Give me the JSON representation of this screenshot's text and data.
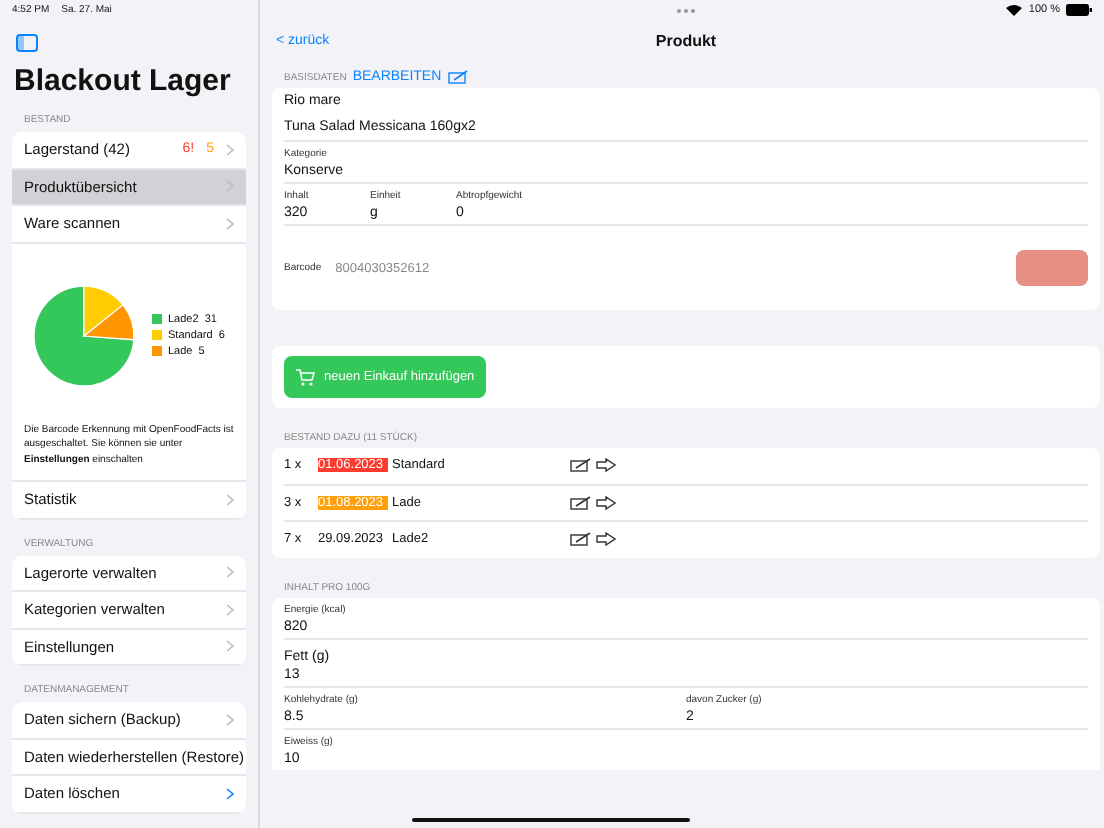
{
  "status_bar": {
    "time": "4:52 PM",
    "date": "Sa. 27. Mai",
    "battery": "100 %"
  },
  "sidebar": {
    "title": "Blackout Lager",
    "sections": [
      {
        "header": "BESTAND",
        "items": [
          {
            "label": "Lagerstand  (42)",
            "badges": [
              {
                "text": "6!",
                "color": "#ff3b30"
              },
              {
                "text": "5",
                "color": "#ff9f0a"
              }
            ],
            "selected": false
          },
          {
            "label": "Produktübersicht",
            "selected": true
          },
          {
            "label": "Ware scannen",
            "selected": false
          }
        ],
        "legend": [
          {
            "label": "Lade2",
            "count": "31",
            "color": "#34c759"
          },
          {
            "label": "Standard",
            "count": "6",
            "color": "#ffcc00"
          },
          {
            "label": "Lade",
            "count": "5",
            "color": "#ff9500"
          }
        ],
        "note": "Die Barcode Erkennung mit OpenFoodFacts ist ausgeschaltet. Sie können sie unter **Einstellungen** einschalten",
        "footer_items": [
          {
            "label": "Statistik",
            "selected": false
          }
        ]
      },
      {
        "header": "VERWALTUNG",
        "items": [
          {
            "label": "Lagerorte verwalten",
            "selected": false
          },
          {
            "label": "Kategorien verwalten",
            "selected": false
          },
          {
            "label": "Einstellungen",
            "selected": false
          }
        ]
      },
      {
        "header": "DATENMANAGEMENT",
        "items": [
          {
            "label": "Daten sichern (Backup)",
            "selected": false
          },
          {
            "label": "Daten wiederherstellen (Restore)",
            "selected": false
          },
          {
            "label": "Daten löschen",
            "selected": false
          }
        ]
      }
    ]
  },
  "nav": {
    "back": "< zurück",
    "title": "Produkt"
  },
  "basisdaten": {
    "header": "BASISDATEN",
    "edit": "BEARBEITEN",
    "brand": "Rio mare",
    "name": "Tuna Salad Messicana 160gx2",
    "category_label": "Kategorie",
    "category": "Konserve",
    "fields": [
      {
        "label": "Inhalt",
        "value": "320"
      },
      {
        "label": "Einheit",
        "value": "g"
      },
      {
        "label": "Abtropfgewicht",
        "value": "0"
      }
    ],
    "barcode_label": "Barcode",
    "barcode": "8004030352612"
  },
  "add_button": "neuen Einkauf hinzufügen",
  "stock": {
    "header": "BESTAND DAZU (11 STÜCK)",
    "rows": [
      {
        "qty": "1 x",
        "date": "01.06.2023",
        "color": "#ff3b30",
        "location": "Standard"
      },
      {
        "qty": "3 x",
        "date": "01.08.2023",
        "color": "#ff9f0a",
        "location": "Lade"
      },
      {
        "qty": "7 x",
        "date": "29.09.2023",
        "location": "Lade2"
      }
    ]
  },
  "nutrition": {
    "header": "INHALT PRO 100G",
    "rows": [
      [
        {
          "label": "Energie  (kcal)",
          "value": "820",
          "large": false
        }
      ],
      [
        {
          "label": "Fett (g)",
          "value": "13",
          "large": true
        }
      ],
      [
        {
          "label": "Kohlehydrate (g)",
          "value": "8.5",
          "large": false
        },
        {
          "label": "davon Zucker (g)",
          "value": "2",
          "large": false
        }
      ],
      [
        {
          "label": "Eiweiss (g)",
          "value": "10",
          "large": false
        }
      ]
    ]
  }
}
